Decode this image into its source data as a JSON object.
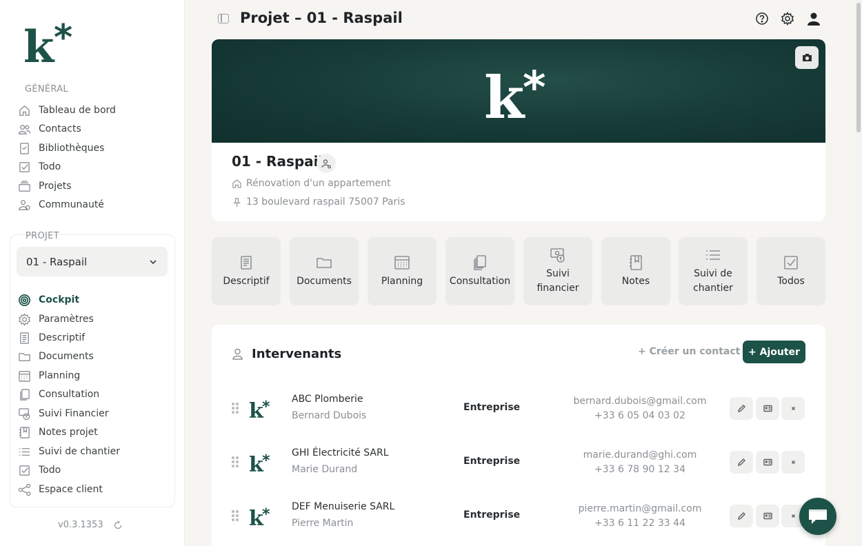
{
  "brand": {
    "logo_text": "k*",
    "primary_color": "#1d5248"
  },
  "sidebar": {
    "general_title": "GÉNÉRAL",
    "general_items": [
      {
        "label": "Tableau de bord",
        "icon": "home-icon"
      },
      {
        "label": "Contacts",
        "icon": "users-icon"
      },
      {
        "label": "Bibliothèques",
        "icon": "bookmark-icon"
      },
      {
        "label": "Todo",
        "icon": "checkbox-icon"
      },
      {
        "label": "Projets",
        "icon": "stack-icon"
      },
      {
        "label": "Communauté",
        "icon": "community-icon"
      }
    ],
    "project_title": "PROJET",
    "project_selected": "01 - Raspail",
    "project_items": [
      {
        "label": "Cockpit",
        "icon": "target-icon",
        "active": true
      },
      {
        "label": "Paramètres",
        "icon": "gear-icon"
      },
      {
        "label": "Descriptif",
        "icon": "document-icon"
      },
      {
        "label": "Documents",
        "icon": "folder-icon"
      },
      {
        "label": "Planning",
        "icon": "calendar-icon"
      },
      {
        "label": "Consultation",
        "icon": "copies-icon"
      },
      {
        "label": "Suivi Financier",
        "icon": "money-icon"
      },
      {
        "label": "Notes projet",
        "icon": "notebook-icon"
      },
      {
        "label": "Suivi de chantier",
        "icon": "list-icon"
      },
      {
        "label": "Todo",
        "icon": "checkbox-icon"
      },
      {
        "label": "Espace client",
        "icon": "share-icon"
      }
    ],
    "version": "v0.3.1353"
  },
  "header": {
    "title": "Projet – 01 - Raspail"
  },
  "project": {
    "name": "01 - Raspail",
    "type": "Rénovation d'un appartement",
    "address": "13 boulevard raspail 75007 Paris"
  },
  "tiles": [
    {
      "label": "Descriptif",
      "icon": "document-icon"
    },
    {
      "label": "Documents",
      "icon": "folder-icon"
    },
    {
      "label": "Planning",
      "icon": "calendar-icon"
    },
    {
      "label": "Consultation",
      "icon": "copies-icon"
    },
    {
      "label": "Suivi financier",
      "icon": "money-icon"
    },
    {
      "label": "Notes",
      "icon": "notebook-icon"
    },
    {
      "label": "Suivi de chantier",
      "icon": "list-icon"
    },
    {
      "label": "Todos",
      "icon": "checkbox-icon"
    }
  ],
  "intervenants": {
    "title": "Intervenants",
    "create_label": "+ Créer un contact",
    "add_label": "+ Ajouter",
    "rows": [
      {
        "company": "ABC Plomberie",
        "person": "Bernard Dubois",
        "role": "Entreprise",
        "email": "bernard.dubois@gmail.com",
        "phone": "+33 6 05 04 03 02"
      },
      {
        "company": "GHI Électricité SARL",
        "person": "Marie Durand",
        "role": "Entreprise",
        "email": "marie.durand@ghi.com",
        "phone": "+33 6 78 90 12 34"
      },
      {
        "company": "DEF Menuiserie SARL",
        "person": "Pierre Martin",
        "role": "Entreprise",
        "email": "pierre.martin@gmail.com",
        "phone": "+33 6 11 22 33 44"
      }
    ]
  }
}
